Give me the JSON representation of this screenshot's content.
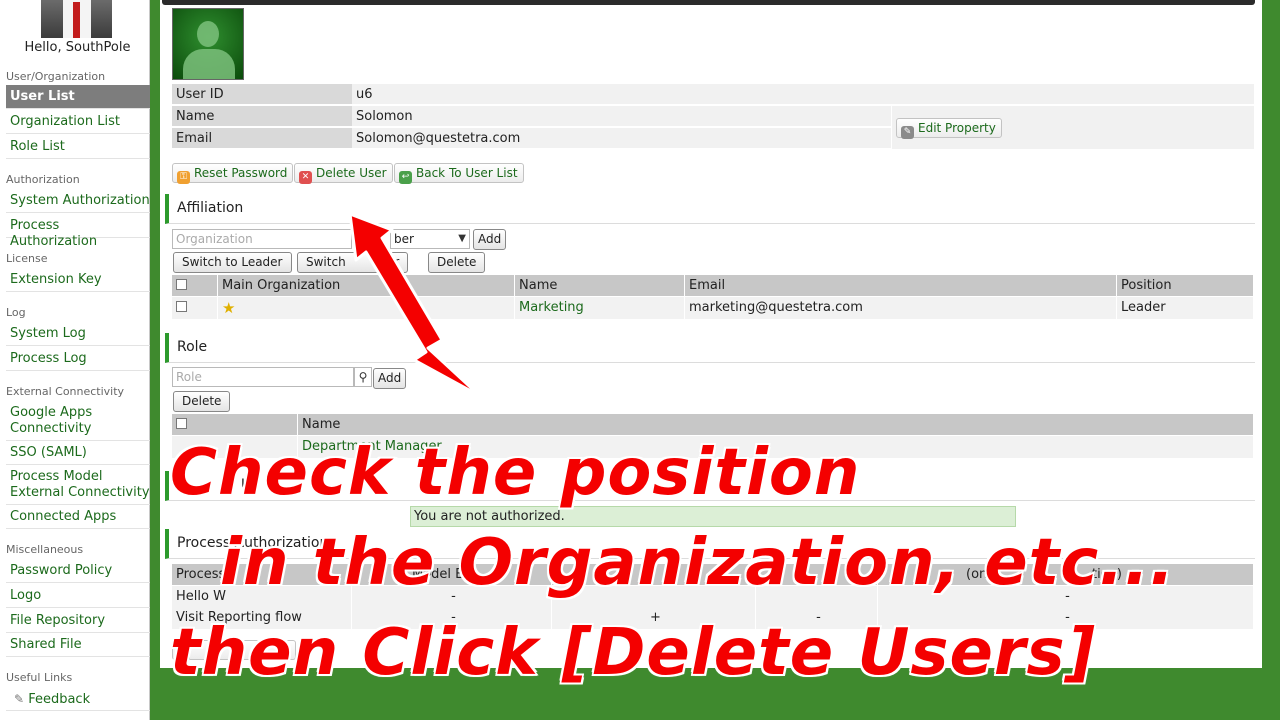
{
  "sidebar": {
    "greeting": "Hello, SouthPole",
    "sections": {
      "user_org": "User/Organization",
      "authorization": "Authorization",
      "license": "License",
      "log": "Log",
      "external": "External Connectivity",
      "misc": "Miscellaneous",
      "useful": "Useful Links"
    },
    "items": {
      "user_list": "User List",
      "org_list": "Organization List",
      "role_list": "Role List",
      "system_auth": "System Authorization",
      "process_auth": "Process Authorization",
      "extension_key": "Extension Key",
      "system_log": "System Log",
      "process_log": "Process Log",
      "google_apps": "Google Apps Connectivity",
      "sso": "SSO (SAML)",
      "process_model_ext": "Process Model External Connectivity",
      "connected_apps": "Connected Apps",
      "password_policy": "Password Policy",
      "logo": "Logo",
      "file_repo": "File Repository",
      "shared_file": "Shared File",
      "feedback": "Feedback"
    }
  },
  "user": {
    "id_label": "User ID",
    "id_value": "u6",
    "name_label": "Name",
    "name_value": "Solomon",
    "email_label": "Email",
    "email_value": "Solomon@questetra.com",
    "edit_property": "Edit Property"
  },
  "actions": {
    "reset_password": "Reset Password",
    "delete_user": "Delete User",
    "back_to_list": "Back To User List"
  },
  "affiliation": {
    "title": "Affiliation",
    "org_placeholder": "Organization",
    "position_select": "ber",
    "add": "Add",
    "switch_leader": "Switch to Leader",
    "switch_member": "Switch",
    "switch_member_suffix": "er",
    "delete": "Delete",
    "headers": [
      "Main Organization",
      "Name",
      "Email",
      "Position"
    ],
    "rows": [
      {
        "name": "Marketing",
        "email": "marketing@questetra.com",
        "position": "Leader"
      }
    ]
  },
  "role": {
    "title": "Role",
    "placeholder": "Role",
    "add": "Add",
    "delete": "Delete",
    "header": "Name",
    "rows": [
      "Department Manager"
    ]
  },
  "system_auth": {
    "title_fragment": "U",
    "notice": "You are not authorized."
  },
  "process_auth": {
    "title": "Process Authorization",
    "headers": [
      "Process",
      "Model Ed",
      "",
      "",
      "(on",
      "tion)"
    ],
    "rows": [
      {
        "name": "Hello W",
        "c1": "-",
        "c2": "",
        "c3": "",
        "c4": "-"
      },
      {
        "name": "Visit Reporting flow",
        "c1": "-",
        "c2": "+",
        "c3": "-",
        "c4": "-"
      }
    ]
  },
  "annotation": {
    "line1": "Check the position",
    "line2": "in the Organization, etc...",
    "line3": "then Click [Delete Users]"
  },
  "colors": {
    "accent": "#2c9a2c",
    "link": "#1c6a1c",
    "annotation": "#f40000",
    "background": "#3f8a2e"
  }
}
